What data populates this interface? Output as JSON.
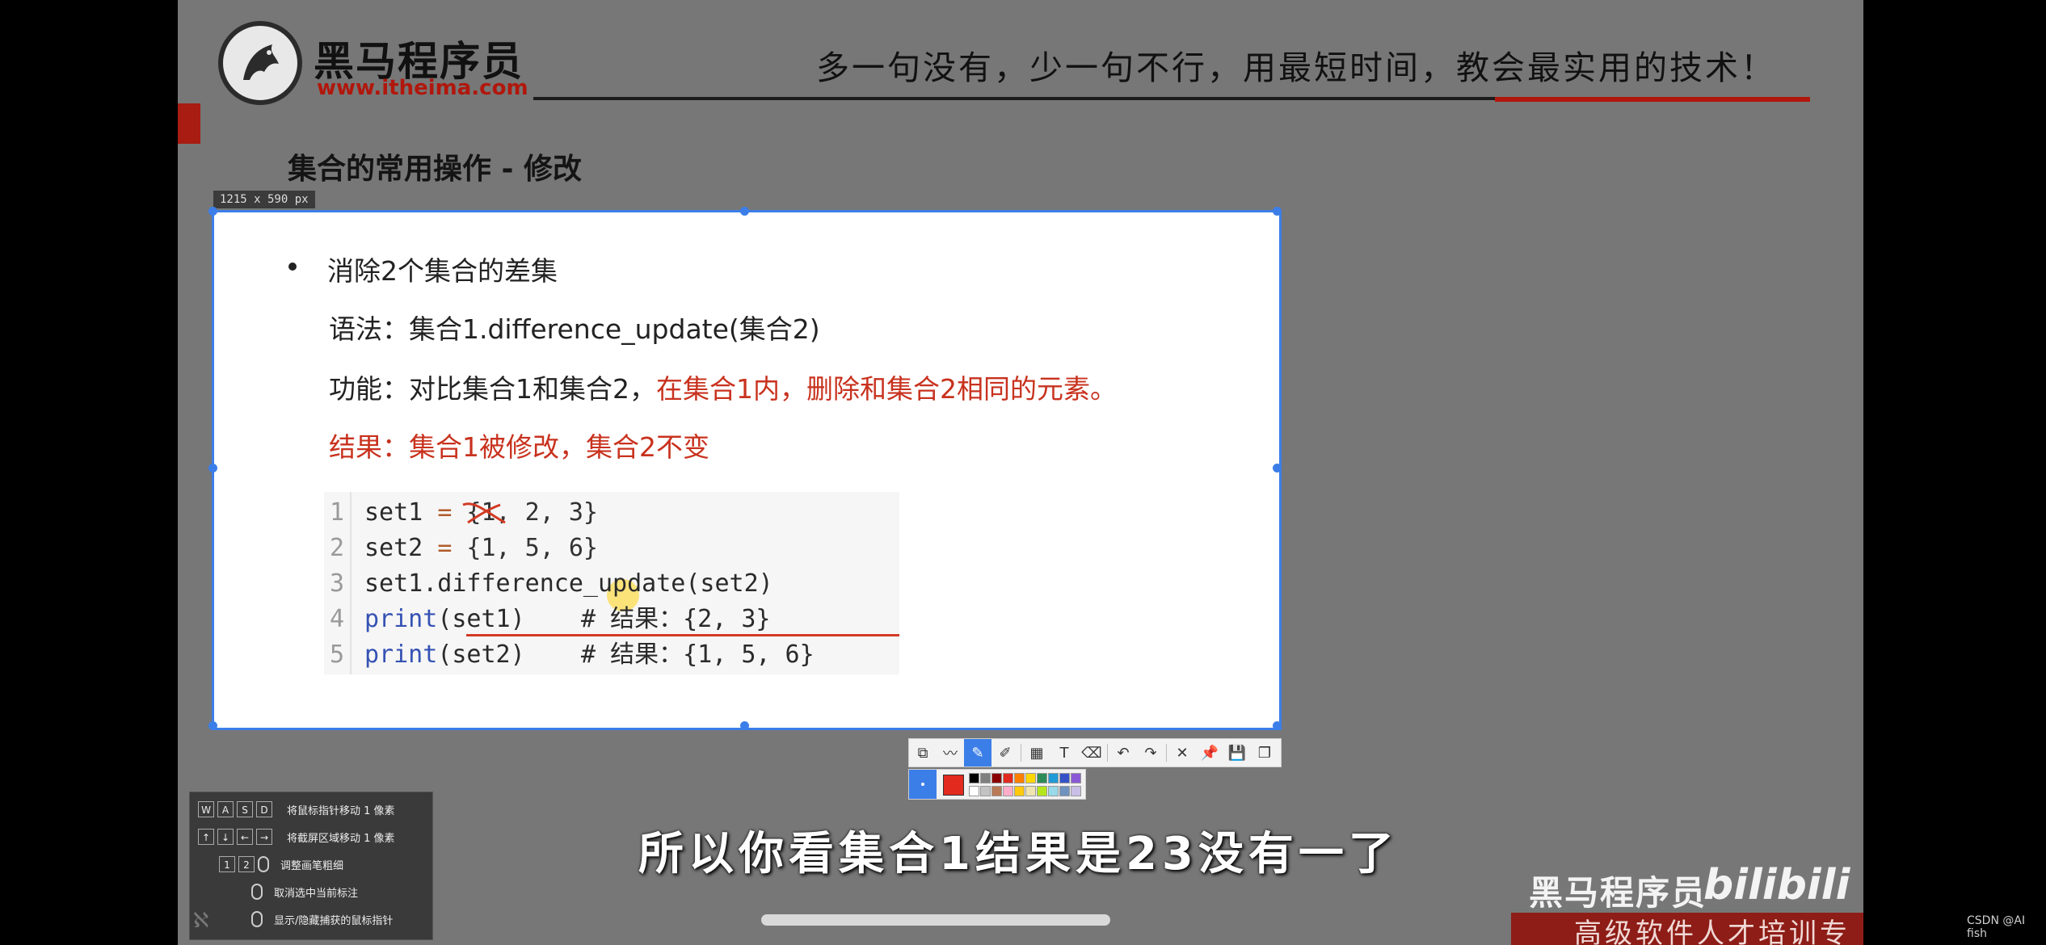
{
  "header": {
    "logo_cn": "黑马程序员",
    "logo_url": "www.itheima.com",
    "slogan": "多一句没有，少一句不行，用最短时间，教会最实用的技术！"
  },
  "page_title": "集合的常用操作 - 修改",
  "capture": {
    "size_tag": "1215 x 590  px"
  },
  "slide": {
    "bullet": "消除2个集合的差集",
    "syntax": "语法：集合1.difference_update(集合2)",
    "function_prefix": "功能：对比集合1和集合2，",
    "function_red": "在集合1内，删除和集合2相同的元素。",
    "result": "结果：集合1被修改，集合2不变"
  },
  "code": {
    "lines": [
      {
        "n": "1",
        "a": "set1 ",
        "op": "=",
        "b": " {1, 2, 3}"
      },
      {
        "n": "2",
        "a": "set2 ",
        "op": "=",
        "b": " {1, 5, 6}"
      },
      {
        "n": "3",
        "a": "set1.difference_update(set2)"
      },
      {
        "n": "4",
        "fn": "print",
        "a": "(set1)",
        "cm": "# 结果：{2, 3}"
      },
      {
        "n": "5",
        "fn": "print",
        "a": "(set2)",
        "cm": "# 结果：{1, 5, 6}"
      }
    ]
  },
  "toolbar": {
    "icons": [
      "rect-select-icon",
      "polyline-icon",
      "pen-icon",
      "highlighter-icon",
      "mosaic-icon",
      "text-icon",
      "eraser-icon",
      "undo-icon",
      "redo-icon",
      "close-icon",
      "pin-icon",
      "save-icon",
      "copy-icon"
    ],
    "glyphs": [
      "⧉",
      "〰",
      "✎",
      "✐",
      "▦",
      "T",
      "⌫",
      "↶",
      "↷",
      "✕",
      "📌",
      "💾",
      "❐"
    ],
    "current_color": "#e22a1f",
    "swatches": [
      "#000000",
      "#7f7f7f",
      "#8b0000",
      "#e22a1f",
      "#ff7f00",
      "#ffd700",
      "#2e8b57",
      "#1f9ad6",
      "#3553c7",
      "#8a5ad6",
      "#ffffff",
      "#c3c3c3",
      "#b97a57",
      "#ffaec9",
      "#ffc90e",
      "#efe4b0",
      "#b5e61d",
      "#99d9ea",
      "#7092be",
      "#c8bfe7"
    ]
  },
  "help": {
    "rows": [
      {
        "keys": [
          "W",
          "A",
          "S",
          "D"
        ],
        "text": "将鼠标指针移动 1 像素"
      },
      {
        "keys": [
          "↑",
          "↓",
          "←",
          "→"
        ],
        "text": "将截屏区域移动 1 像素"
      },
      {
        "keys": [
          "1",
          "2"
        ],
        "text": "调整画笔粗细"
      },
      {
        "keys": [],
        "text": "取消选中当前标注"
      },
      {
        "keys": [],
        "text": "显示/隐藏捕获的鼠标指针"
      }
    ]
  },
  "subtitle": "所以你看集合1结果是23没有一了",
  "watermark": {
    "cn": "黑马程序员",
    "bili": "bilibili",
    "footer": "高级软件人才培训专家",
    "csdn": "CSDN @AI fish"
  }
}
